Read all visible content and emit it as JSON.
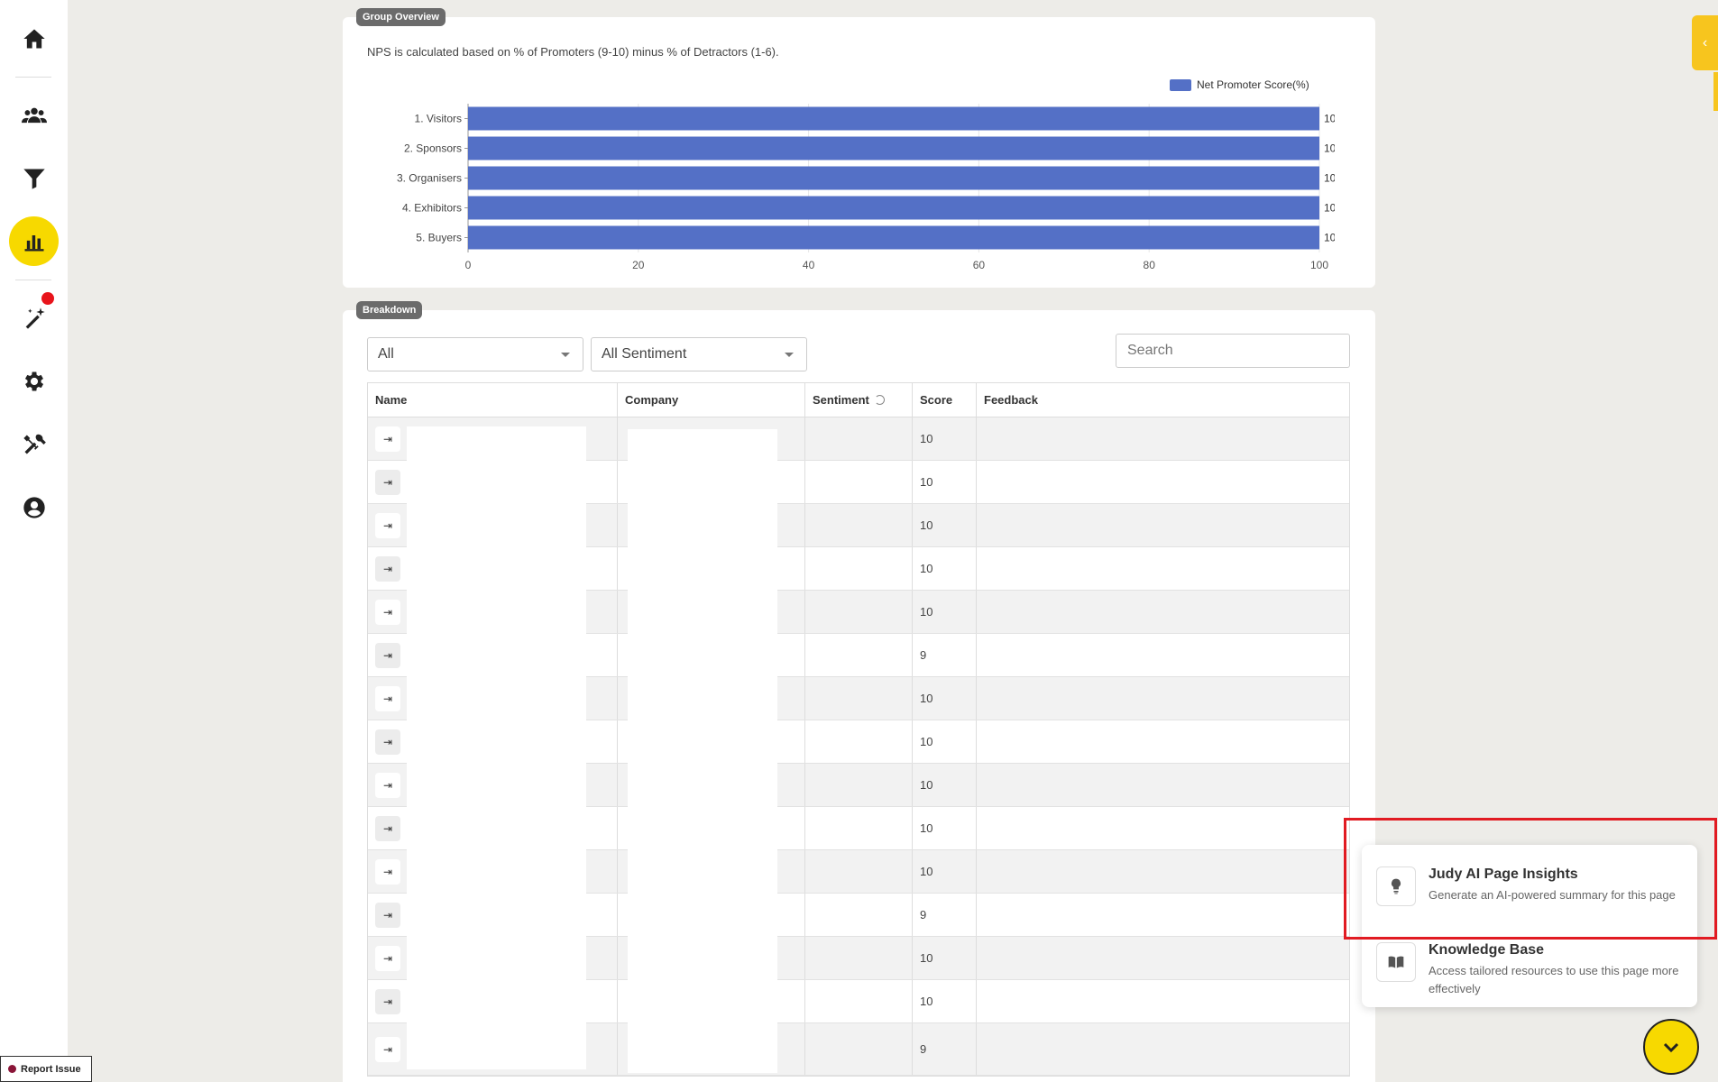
{
  "sidebar": {
    "items": [
      {
        "name": "home-icon"
      },
      {
        "name": "users-icon"
      },
      {
        "name": "filter-icon"
      },
      {
        "name": "bar-chart-icon",
        "active": true
      },
      {
        "name": "magic-wand-icon",
        "notification": true
      },
      {
        "name": "gear-icon"
      },
      {
        "name": "tools-icon"
      },
      {
        "name": "user-circle-icon"
      }
    ]
  },
  "overview": {
    "tag": "Group Overview",
    "note": "NPS is calculated based on % of Promoters (9-10) minus % of Detractors (1-6).",
    "legend": "Net Promoter Score(%)"
  },
  "chart_data": {
    "type": "bar",
    "orientation": "horizontal",
    "categories": [
      "1. Visitors",
      "2. Sponsors",
      "3. Organisers",
      "4. Exhibitors",
      "5. Buyers"
    ],
    "series": [
      {
        "name": "Net Promoter Score(%)",
        "values": [
          100,
          100,
          100,
          100,
          100
        ]
      }
    ],
    "xlim": [
      0,
      100
    ],
    "xticks": [
      0,
      20,
      40,
      60,
      80,
      100
    ],
    "color": "#5470c6",
    "legend_position": "top-right",
    "grid": true
  },
  "breakdown": {
    "tag": "Breakdown",
    "filter_group": "All",
    "filter_sentiment": "All Sentiment",
    "search_placeholder": "Search",
    "columns": {
      "name": "Name",
      "company": "Company",
      "sentiment": "Sentiment",
      "score": "Score",
      "feedback": "Feedback"
    },
    "rows": [
      {
        "score": "10"
      },
      {
        "score": "10"
      },
      {
        "score": "10"
      },
      {
        "score": "10"
      },
      {
        "score": "10"
      },
      {
        "score": "9"
      },
      {
        "score": "10"
      },
      {
        "score": "10"
      },
      {
        "score": "10"
      },
      {
        "score": "10"
      },
      {
        "score": "10"
      },
      {
        "score": "9"
      },
      {
        "score": "10"
      },
      {
        "score": "10"
      },
      {
        "score": "9"
      }
    ]
  },
  "popup": {
    "insights_title": "Judy AI Page Insights",
    "insights_desc": "Generate an AI-powered summary for this page",
    "kb_title": "Knowledge Base",
    "kb_desc": "Access tailored resources to use this page more effectively"
  },
  "report_issue": "Report Issue",
  "colors": {
    "accent": "#f7d900",
    "bar": "#5470c6",
    "highlight": "#e11b22"
  }
}
